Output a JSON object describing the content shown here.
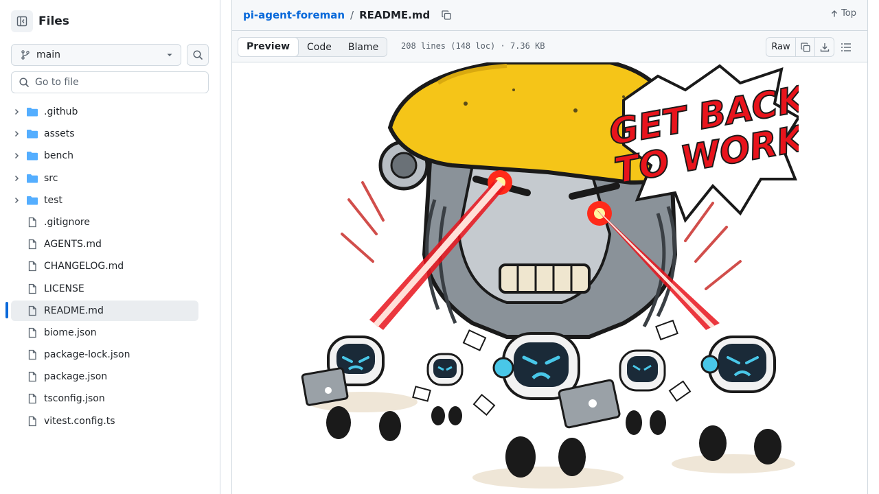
{
  "sidebar": {
    "title": "Files",
    "branch": "main",
    "goto_placeholder": "Go to file",
    "items": [
      {
        "label": ".github",
        "type": "folder"
      },
      {
        "label": "assets",
        "type": "folder"
      },
      {
        "label": "bench",
        "type": "folder"
      },
      {
        "label": "src",
        "type": "folder"
      },
      {
        "label": "test",
        "type": "folder"
      },
      {
        "label": ".gitignore",
        "type": "file"
      },
      {
        "label": "AGENTS.md",
        "type": "file"
      },
      {
        "label": "CHANGELOG.md",
        "type": "file"
      },
      {
        "label": "LICENSE",
        "type": "file"
      },
      {
        "label": "README.md",
        "type": "file",
        "selected": true
      },
      {
        "label": "biome.json",
        "type": "file"
      },
      {
        "label": "package-lock.json",
        "type": "file"
      },
      {
        "label": "package.json",
        "type": "file"
      },
      {
        "label": "tsconfig.json",
        "type": "file"
      },
      {
        "label": "vitest.config.ts",
        "type": "file"
      }
    ]
  },
  "header": {
    "repo": "pi-agent-foreman",
    "separator": "/",
    "file": "README.md",
    "top_label": "Top"
  },
  "filebar": {
    "tabs": [
      {
        "label": "Preview",
        "active": true
      },
      {
        "label": "Code"
      },
      {
        "label": "Blame"
      }
    ],
    "meta": "208 lines (148 loc) · 7.36 KB",
    "raw_label": "Raw"
  },
  "preview": {
    "headline_line1": "GET BACK",
    "headline_line2": "TO WORK!",
    "illustration": "angry-robot-foreman-with-hard-hat-chasing-small-robots"
  },
  "colors": {
    "accent": "#0969da",
    "folder": "#54aeff",
    "hardhat": "#f5c518",
    "laser": "#e8141c",
    "robot_face": "#49c7e8"
  }
}
